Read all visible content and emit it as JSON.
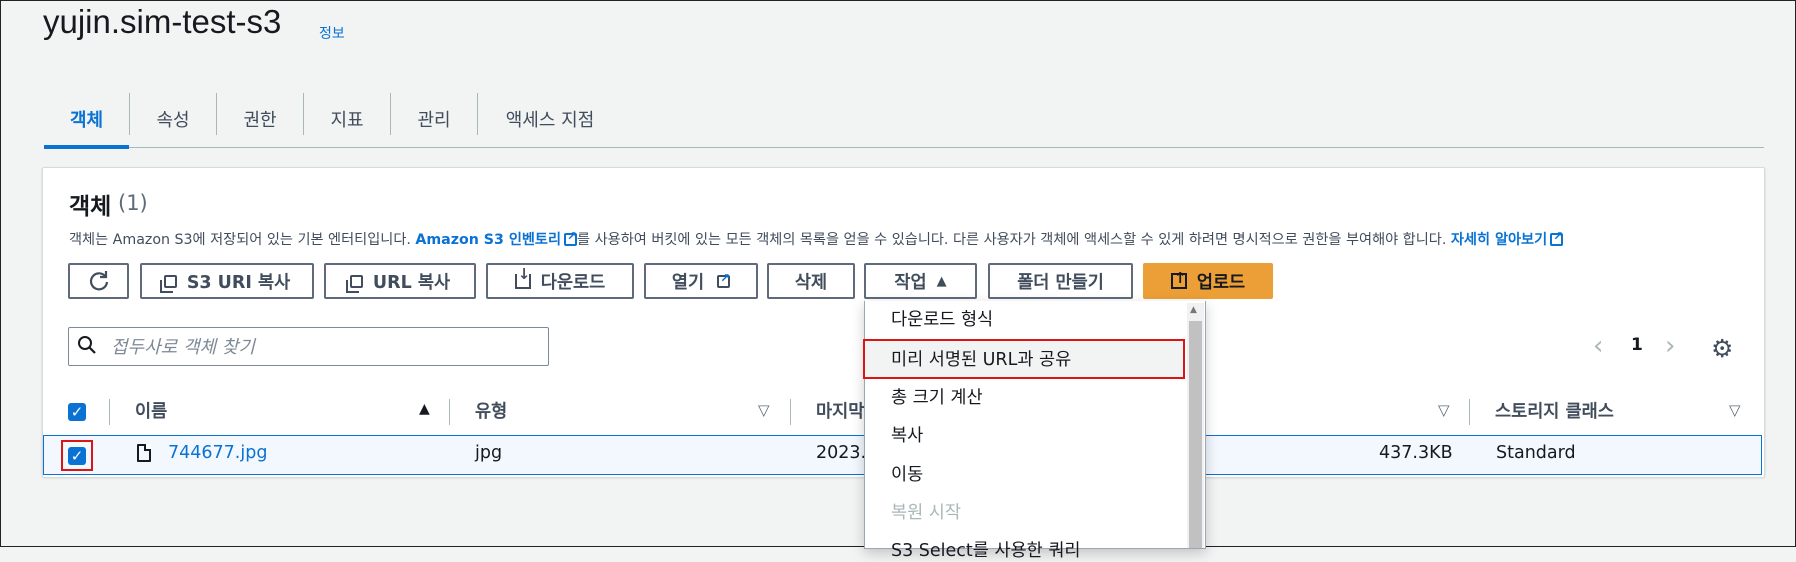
{
  "page": {
    "title": "yujin.sim-test-s3",
    "info_link": "정보"
  },
  "tabs": [
    {
      "label": "객체"
    },
    {
      "label": "속성"
    },
    {
      "label": "권한"
    },
    {
      "label": "지표"
    },
    {
      "label": "관리"
    },
    {
      "label": "액세스 지점"
    }
  ],
  "panel": {
    "title": "객체",
    "count": "(1)",
    "description_pre": "객체는 Amazon S3에 저장되어 있는 기본 엔터티입니다. ",
    "inventory_link": "Amazon S3 인벤토리",
    "description_mid": "를 사용하여 버킷에 있는 모든 객체의 목록을 얻을 수 있습니다. 다른 사용자가 객체에 액세스할 수 있게 하려면 명시적으로 권한을 부여해야 합니다. ",
    "learn_more_link": "자세히 알아보기"
  },
  "toolbar": {
    "refresh_icon": "refresh-icon",
    "copy_s3_uri": "S3 URI 복사",
    "copy_url": "URL 복사",
    "download": "다운로드",
    "open": "열기",
    "delete": "삭제",
    "actions": "작업",
    "create_folder": "폴더 만들기",
    "upload": "업로드"
  },
  "search": {
    "placeholder": "접두사로 객체 찾기"
  },
  "pagination": {
    "current_page": "1"
  },
  "table": {
    "columns": {
      "name": "이름",
      "type": "유형",
      "last_modified": "마지막",
      "storage_class": "스토리지 클래스"
    },
    "rows": [
      {
        "name": "744677.jpg",
        "type": "jpg",
        "last_modified": "2023.",
        "size": "437.3KB",
        "storage_class": "Standard",
        "selected": true
      }
    ]
  },
  "actions_menu": {
    "items": [
      {
        "label": "다운로드 형식",
        "disabled": false
      },
      {
        "label": "미리 서명된 URL과 공유",
        "disabled": false,
        "highlighted": true
      },
      {
        "label": "총 크기 계산",
        "disabled": false
      },
      {
        "label": "복사",
        "disabled": false
      },
      {
        "label": "이동",
        "disabled": false
      },
      {
        "label": "복원 시작",
        "disabled": true
      },
      {
        "label": "S3 Select를 사용한 쿼리",
        "disabled": false
      }
    ]
  },
  "colors": {
    "accent": "#0972d3",
    "primary_button": "#ec9f36",
    "highlight_outline": "#d91515"
  }
}
